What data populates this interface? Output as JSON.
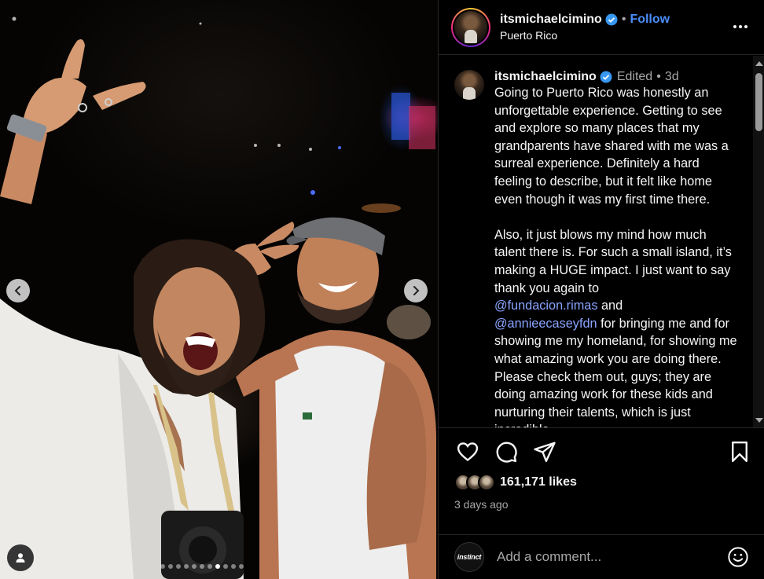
{
  "post": {
    "username": "itsmichaelcimino",
    "follow_label": "Follow",
    "separator": "•",
    "location": "Puerto Rico",
    "verified": true
  },
  "caption": {
    "username": "itsmichaelcimino",
    "edited": "Edited",
    "dot": "•",
    "time": "3d",
    "text_part1": "Going to Puerto Rico was honestly an unforgettable experience. Getting to see and explore so many places that my grandparents have shared with me was a surreal experience. Definitely a hard feeling to describe, but it felt like home even though it was my first time there.\n\nAlso, it just blows my mind how much talent there is. For such a small island, it’s making a HUGE impact. I just want to say thank you again to\n",
    "mention1": "@fundacion.rimas",
    "text_part2": " and\n",
    "mention2": "@annieecaseyfdn",
    "text_part3": " for bringing me and for showing me my homeland, for showing me what amazing work you are doing there. Please check them out, guys; they are doing amazing work for these kids and nurturing their talents, which is just incredible."
  },
  "engagement": {
    "likes": "161,171 likes",
    "date": "3 days ago"
  },
  "comment_box": {
    "placeholder": "Add a comment...",
    "user_avatar_text": "instinct"
  },
  "carousel": {
    "total": 11,
    "active_index": 7
  },
  "icons": {
    "like": "heart-icon",
    "comment": "comment-icon",
    "share": "share-icon",
    "save": "bookmark-icon",
    "emoji": "emoji-icon",
    "more": "more-options-icon",
    "verified": "verified-badge-icon",
    "tag": "user-tag-icon"
  },
  "colors": {
    "follow": "#4a8df8",
    "mention": "#8aa4ff",
    "verified": "#3897f0"
  }
}
